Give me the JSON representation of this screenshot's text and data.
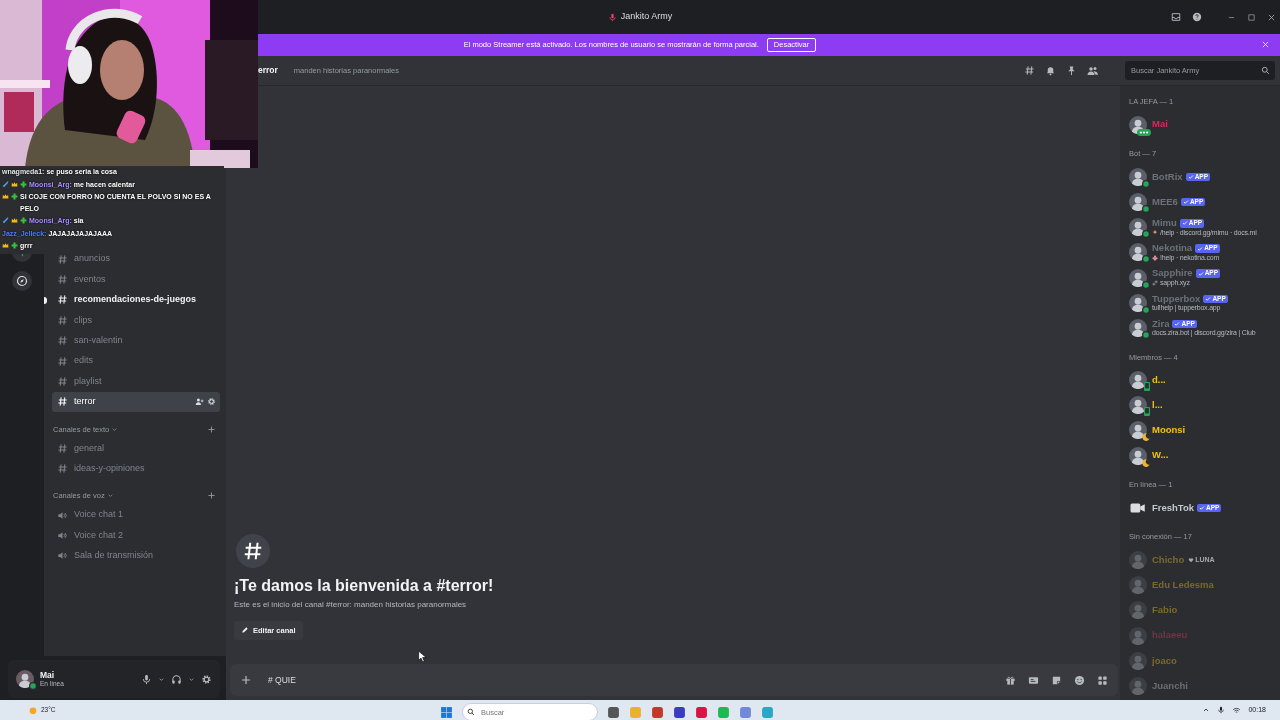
{
  "window": {
    "title": "Jankito Army"
  },
  "banner": {
    "text": "El modo Streamer está activado. Los nombres de usuario se mostrarán de forma parcial.",
    "button": "Desactivar"
  },
  "stream_chat": [
    {
      "name": "wnagmeda1:",
      "color": "#e6e6e6",
      "message": "se puso seria la cosa"
    },
    {
      "name": "Moonsi_Arg:",
      "color": "#a98bff",
      "badges": [
        {
          "kind": "sword"
        },
        {
          "kind": "crown"
        },
        {
          "kind": "plus"
        }
      ],
      "message": "me hacen calentar"
    },
    {
      "badges": [
        {
          "kind": "crown"
        },
        {
          "kind": "plus"
        }
      ],
      "message": "SI COJE CON FORRO NO CUENTA EL POLVO SI NO ES A PELO"
    },
    {
      "name": "Moonsi_Arg:",
      "color": "#a98bff",
      "badges": [
        {
          "kind": "sword"
        },
        {
          "kind": "crown"
        },
        {
          "kind": "plus"
        }
      ],
      "message": "sia"
    },
    {
      "name": "Jazz_Jelleck:",
      "color": "#4a7dff",
      "message": "JAJAJAJAJAJAAA"
    },
    {
      "badges": [
        {
          "kind": "crown"
        },
        {
          "kind": "plus"
        }
      ],
      "message": "grrr"
    }
  ],
  "channels": [
    {
      "name": "anuncios",
      "kind": "text",
      "selected": false,
      "unread": false
    },
    {
      "name": "eventos",
      "kind": "text",
      "selected": false,
      "unread": false
    },
    {
      "name": "recomendaciones-de-juegos",
      "kind": "text",
      "selected": false,
      "unread": true
    },
    {
      "name": "clips",
      "kind": "text",
      "selected": false,
      "unread": false
    },
    {
      "name": "san-valentin",
      "kind": "text",
      "selected": false,
      "unread": false
    },
    {
      "name": "edits",
      "kind": "text",
      "selected": false,
      "unread": false
    },
    {
      "name": "playlist",
      "kind": "text",
      "selected": false,
      "unread": false
    },
    {
      "name": "terror",
      "kind": "text",
      "selected": true,
      "unread": false
    }
  ],
  "categories": [
    {
      "label": "Canales de texto",
      "channels": [
        {
          "name": "general",
          "kind": "text",
          "selected": false,
          "unread": false
        },
        {
          "name": "ideas-y-opiniones",
          "kind": "text",
          "selected": false,
          "unread": false
        }
      ]
    },
    {
      "label": "Canales de voz",
      "channels": [
        {
          "name": "Voice chat 1",
          "kind": "voice",
          "selected": false,
          "unread": false
        },
        {
          "name": "Voice chat 2",
          "kind": "voice",
          "selected": false,
          "unread": false
        },
        {
          "name": "Sala de transmisión",
          "kind": "voice",
          "selected": false,
          "unread": false
        }
      ]
    }
  ],
  "user_panel": {
    "name": "Mai",
    "status": "En línea"
  },
  "header": {
    "channel": "error",
    "topic": "manden historias paranormales",
    "search": {
      "placeholder": "Buscar Jankito Army"
    }
  },
  "welcome": {
    "title": "¡Te damos la bienvenida a #terror!",
    "subtitle": "Este es el inicio del canal #terror: manden historias paranormales",
    "button": "Editar canal"
  },
  "composer": {
    "value": "# QUIE"
  },
  "member_groups": [
    {
      "label": "LA JEFA — 1",
      "members": [
        {
          "name": "Mai",
          "color": "#e0245e",
          "kind": "typing"
        }
      ]
    },
    {
      "label": "Bot — 7",
      "members": [
        {
          "name": "BotRix",
          "color": "#6d717a",
          "kind": "online",
          "badge": "APP"
        },
        {
          "name": "MEE6",
          "color": "#6d717a",
          "kind": "online",
          "badge": "APP"
        },
        {
          "name": "Mimu",
          "color": "#6d717a",
          "kind": "online",
          "badge": "APP",
          "sub_icon": {
            "kind": "sparkle"
          },
          "subtitle": "/help · discord.gg/mimu · docs.mi"
        },
        {
          "name": "Nekotina",
          "color": "#6d717a",
          "kind": "online",
          "badge": "APP",
          "sub_icon": {
            "kind": "flower"
          },
          "subtitle": "!help · nekotina.com"
        },
        {
          "name": "Sapphire",
          "color": "#6d717a",
          "kind": "online",
          "badge": "APP",
          "sub_icon": {
            "kind": "link"
          },
          "subtitle": "sapph.xyz"
        },
        {
          "name": "Tupperbox",
          "color": "#6d717a",
          "kind": "online",
          "badge": "APP",
          "subtitle": "tul!help | tupperbox.app"
        },
        {
          "name": "Zira",
          "color": "#6d717a",
          "kind": "online",
          "badge": "APP",
          "subtitle": "docs.zira.bot | discord.gg/zira | Club"
        }
      ]
    },
    {
      "label": "Miembros — 4",
      "members": [
        {
          "name": "d...",
          "color": "#f1c40f",
          "kind": "mobile"
        },
        {
          "name": "l...",
          "color": "#f1c40f",
          "kind": "mobile"
        },
        {
          "name": "Moonsi",
          "color": "#f1c40f",
          "kind": "idle"
        },
        {
          "name": "W...",
          "color": "#f1c40f",
          "kind": "idle"
        }
      ]
    },
    {
      "label": "En línea — 1",
      "members": [
        {
          "name": "FreshTok",
          "color": "#c4c9ce",
          "kind": "plain",
          "badge": "APP"
        }
      ]
    },
    {
      "label": "Sin conexión — 17",
      "members": [
        {
          "name": "Chicho",
          "color": "#7a6a2a",
          "kind": "offline",
          "tag": "LUNA"
        },
        {
          "name": "Edu Ledesma",
          "color": "#7a6a2a",
          "kind": "offline"
        },
        {
          "name": "Fabio",
          "color": "#7a6a2a",
          "kind": "offline"
        },
        {
          "name": "halaeeu",
          "color": "#7a2e44",
          "kind": "offline"
        },
        {
          "name": "joaco",
          "color": "#7a6a2a",
          "kind": "offline"
        },
        {
          "name": "Juanchi",
          "color": "#6a6d74",
          "kind": "offline"
        }
      ]
    }
  ],
  "taskbar": {
    "weather": "23°C",
    "search": {
      "placeholder": "Buscar"
    },
    "time": "00:18"
  }
}
